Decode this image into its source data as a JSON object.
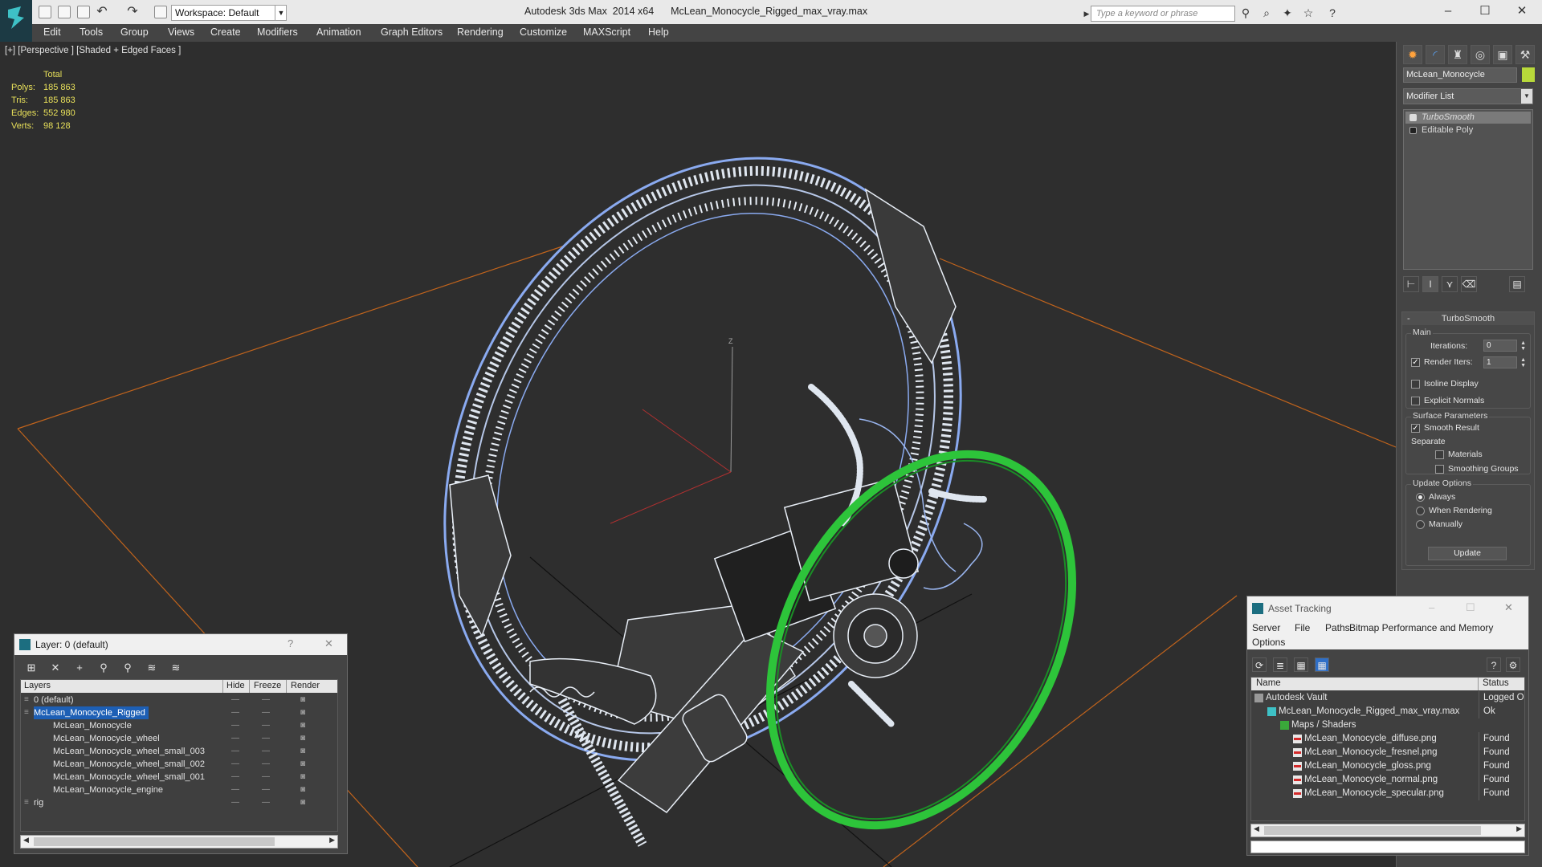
{
  "window": {
    "app_title": "Autodesk 3ds Max  2014 x64",
    "file_title": "McLean_Monocycle_Rigged_max_vray.max",
    "workspace": "Workspace: Default",
    "search_placeholder": "Type a keyword or phrase"
  },
  "menu": [
    "Edit",
    "Tools",
    "Group",
    "Views",
    "Create",
    "Modifiers",
    "Animation",
    "Graph Editors",
    "Rendering",
    "Customize",
    "MAXScript",
    "Help"
  ],
  "viewport": {
    "label": "[+] [Perspective ] [Shaded + Edged Faces ]",
    "stats_header": "Total",
    "stats": [
      {
        "key": "Polys:",
        "value": "185 863"
      },
      {
        "key": "Tris:",
        "value": "185 863"
      },
      {
        "key": "Edges:",
        "value": "552 980"
      },
      {
        "key": "Verts:",
        "value": "98 128"
      }
    ],
    "gizmo_label": "Z",
    "colors": {
      "wire": "#dfe6ef",
      "wire_blue": "#8aaaf0",
      "selected": "#2dc43a",
      "grid": "#c2641c",
      "stats": "#e8e05a"
    }
  },
  "command_panel": {
    "object_name": "McLean_Monocycle",
    "object_color": "#b8d93a",
    "modifier_list": "Modifier List",
    "stack": [
      {
        "label": "TurboSmooth",
        "selected": true
      },
      {
        "label": "Editable Poly",
        "selected": false
      }
    ],
    "turbosmooth": {
      "title": "TurboSmooth",
      "main_group": "Main",
      "iterations_label": "Iterations:",
      "iterations_value": "0",
      "render_iters_label": "Render Iters:",
      "render_iters_value": "1",
      "render_iters_checked": true,
      "isoline_label": "Isoline Display",
      "explicit_normals_label": "Explicit Normals",
      "surface_group": "Surface Parameters",
      "smooth_result_label": "Smooth Result",
      "separate_label": "Separate",
      "materials_label": "Materials",
      "smoothing_groups_label": "Smoothing Groups",
      "update_group": "Update Options",
      "always_label": "Always",
      "when_rendering_label": "When Rendering",
      "manually_label": "Manually",
      "update_button": "Update"
    }
  },
  "layer_dialog": {
    "title": "Layer: 0 (default)",
    "help": "?",
    "close": "✕",
    "columns": {
      "layers": "Layers",
      "hide": "Hide",
      "freeze": "Freeze",
      "render": "Render"
    },
    "rows": [
      {
        "name": "0 (default)",
        "indent": 0,
        "selected": false
      },
      {
        "name": "McLean_Monocycle_Rigged",
        "indent": 0,
        "selected": true
      },
      {
        "name": "McLean_Monocycle",
        "indent": 1,
        "selected": false
      },
      {
        "name": "McLean_Monocycle_wheel",
        "indent": 1,
        "selected": false
      },
      {
        "name": "McLean_Monocycle_wheel_small_003",
        "indent": 1,
        "selected": false
      },
      {
        "name": "McLean_Monocycle_wheel_small_002",
        "indent": 1,
        "selected": false
      },
      {
        "name": "McLean_Monocycle_wheel_small_001",
        "indent": 1,
        "selected": false
      },
      {
        "name": "McLean_Monocycle_engine",
        "indent": 1,
        "selected": false
      },
      {
        "name": "rig",
        "indent": 0,
        "selected": false
      }
    ]
  },
  "asset_dialog": {
    "title": "Asset Tracking",
    "menu": [
      "Server",
      "File",
      "Paths",
      "Bitmap Performance and Memory",
      "Options"
    ],
    "columns": {
      "name": "Name",
      "status": "Status"
    },
    "rows": [
      {
        "name": "Autodesk Vault",
        "status": "Logged O",
        "indent": 0
      },
      {
        "name": "McLean_Monocycle_Rigged_max_vray.max",
        "status": "Ok",
        "indent": 1
      },
      {
        "name": "Maps / Shaders",
        "status": "",
        "indent": 2
      },
      {
        "name": "McLean_Monocycle_diffuse.png",
        "status": "Found",
        "indent": 3
      },
      {
        "name": "McLean_Monocycle_fresnel.png",
        "status": "Found",
        "indent": 3
      },
      {
        "name": "McLean_Monocycle_gloss.png",
        "status": "Found",
        "indent": 3
      },
      {
        "name": "McLean_Monocycle_normal.png",
        "status": "Found",
        "indent": 3
      },
      {
        "name": "McLean_Monocycle_specular.png",
        "status": "Found",
        "indent": 3
      }
    ]
  }
}
